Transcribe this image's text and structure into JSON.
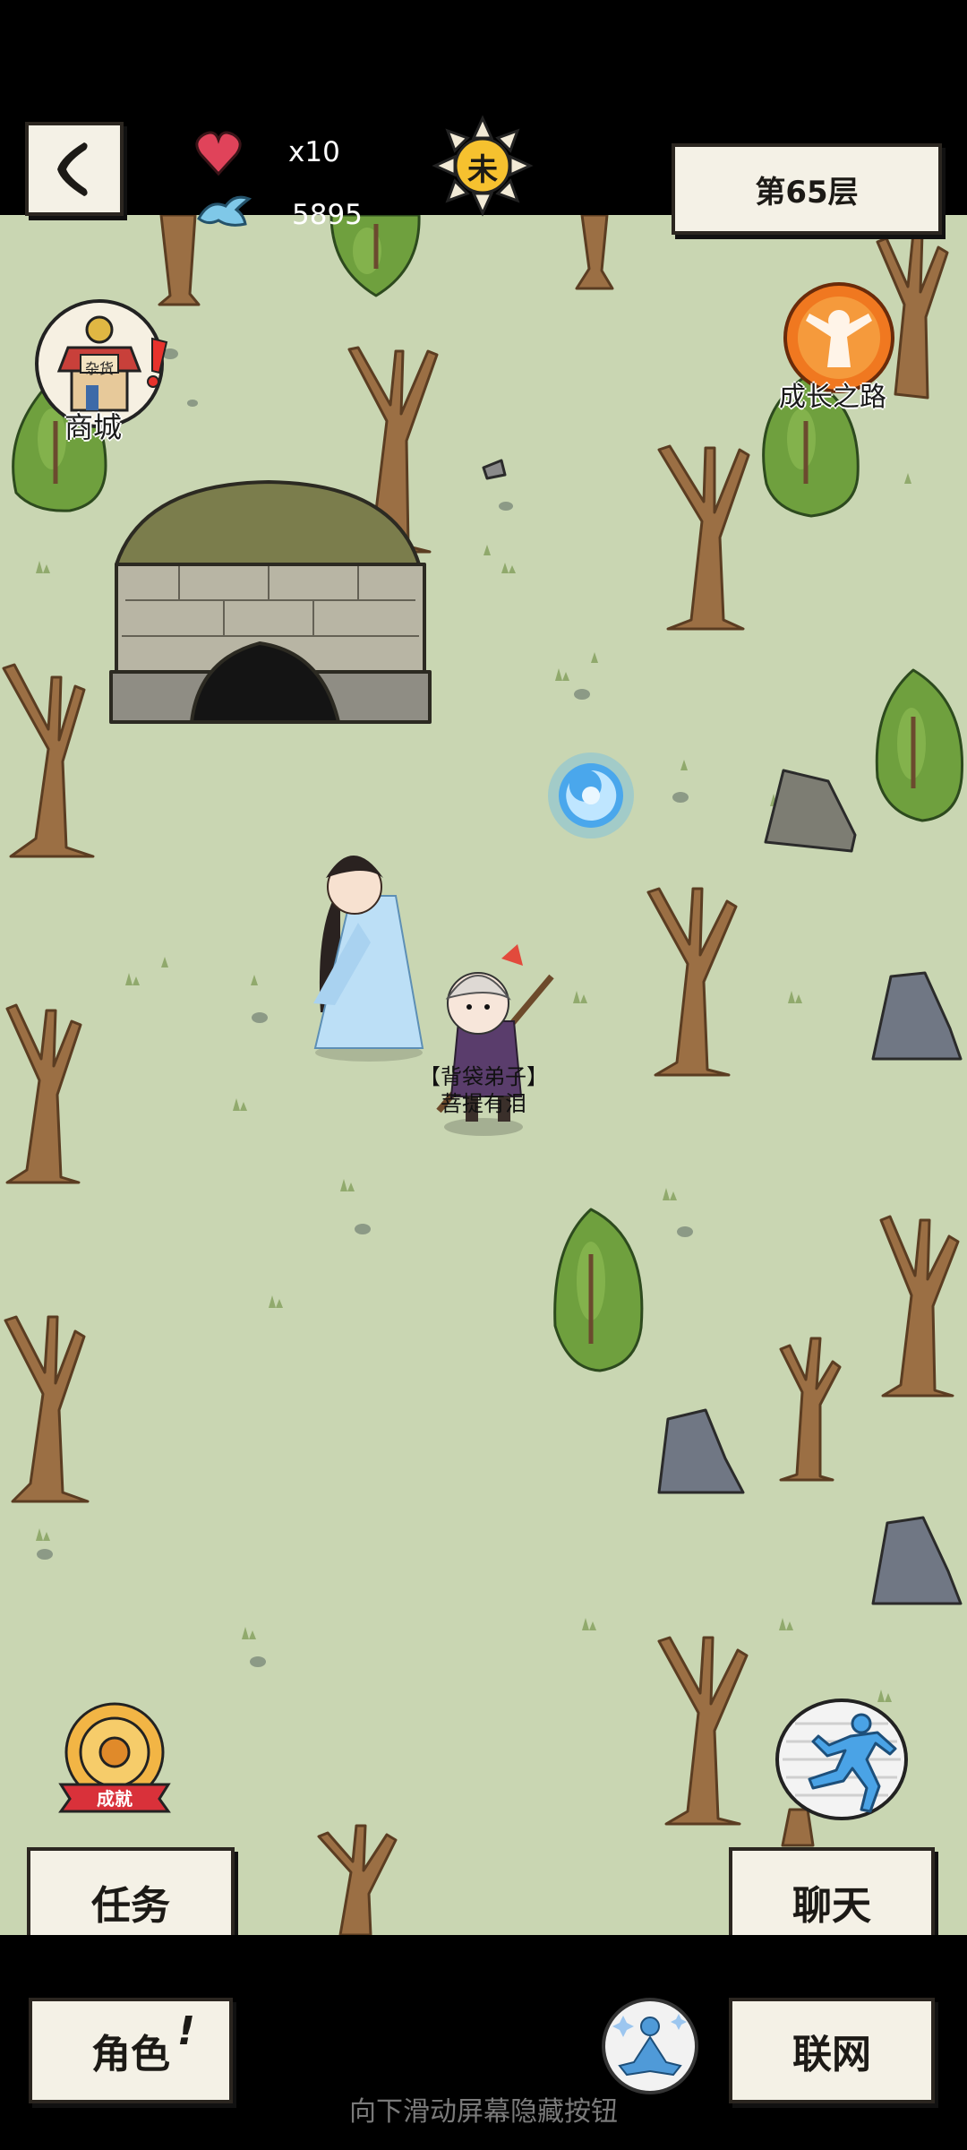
{
  "header": {
    "lives_value": "x10",
    "spirit_value": "5895",
    "time_glyph": "未",
    "floor_label": "第65层"
  },
  "shortcuts": {
    "shop_label": "商城",
    "shop_sign": "杂货",
    "growth_label": "成长之路",
    "achievement_ribbon": "成就"
  },
  "npc": {
    "title": "【背袋弟子】",
    "name": "菩提有泪"
  },
  "buttons": {
    "task": "任务",
    "chat": "聊天",
    "role": "角色",
    "role_mark": "!",
    "network": "联网"
  },
  "footer_hint": "向下滑动屏幕隐藏按钮",
  "icons": [
    "back-chevron-icon",
    "heart-icon",
    "spirit-bird-icon",
    "sun-time-icon",
    "shop-stall-icon",
    "alert-icon",
    "growth-figure-icon",
    "achievement-medal-icon",
    "sprint-runner-icon",
    "meditate-icon",
    "portal-icon"
  ],
  "colors": {
    "map_bg": "#c9d6b2",
    "paper": "#f4f1e6",
    "heart": "#e0435a",
    "portal": "#58b6f2",
    "growth_orange": "#f07820"
  }
}
